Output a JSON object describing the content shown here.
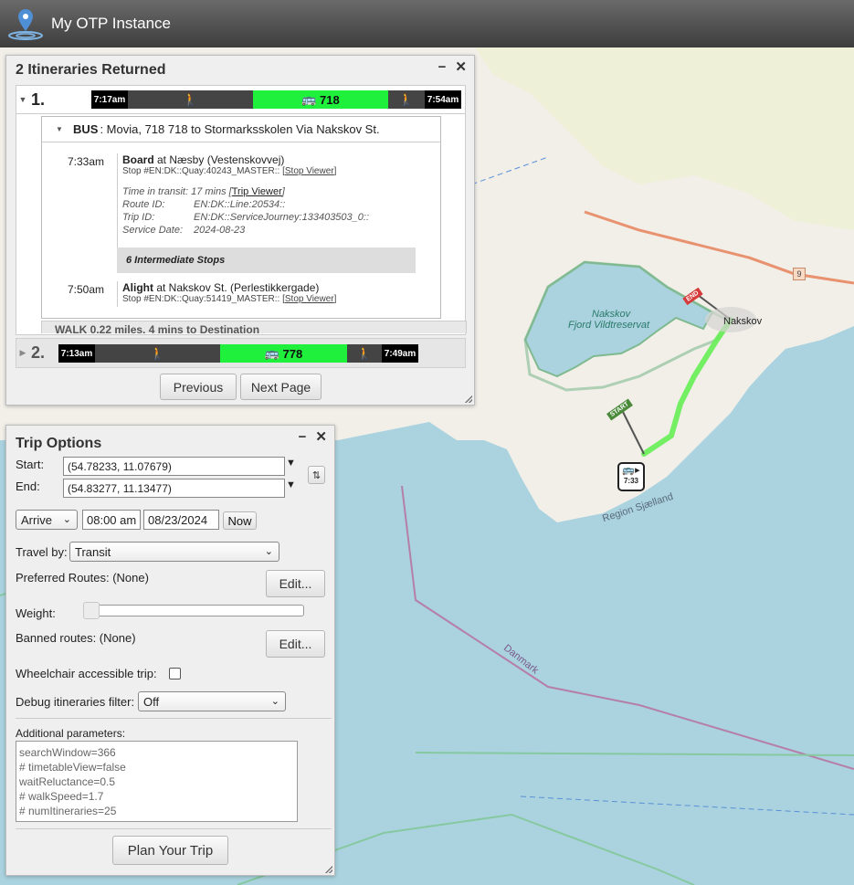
{
  "app": {
    "title": "My OTP Instance"
  },
  "map": {
    "labels": {
      "fjord1": "Nakskov",
      "fjord2": "Fjord Vildtreservat",
      "town": "Nakskov",
      "road_shield": "9",
      "region": "Region Sjælland",
      "border": "Danmark",
      "pin_time": "7:33",
      "start_flag": "START",
      "end_flag": "END"
    },
    "colors": {
      "water": "#aad3df",
      "land": "#f2efe9",
      "route": "#66ee55"
    }
  },
  "itineraries_panel": {
    "title": "2 Itineraries Returned",
    "minimize": "−",
    "close": "✕",
    "itineraries": [
      {
        "num": "1.",
        "start": "7:17am",
        "route": "718",
        "end": "7:54am"
      },
      {
        "num": "2.",
        "start": "7:13am",
        "route": "778",
        "end": "7:49am"
      }
    ],
    "leg": {
      "mode": "BUS",
      "summary": ": Movia, 718 718 to Stormarksskolen Via Nakskov St.",
      "board_time": "7:33am",
      "board_label": "Board",
      "board_text": " at Næsby (Vestenskovvej)",
      "board_stop": "Stop #EN:DK::Quay:40243_MASTER::",
      "stop_viewer": "Stop Viewer",
      "transit_time": "Time in transit: 17 mins",
      "trip_viewer": "Trip Viewer",
      "route_id_k": "Route ID:",
      "route_id_v": "EN:DK::Line:20534::",
      "trip_id_k": "Trip ID:",
      "trip_id_v": "EN:DK::ServiceJourney:133403503_0::",
      "service_date_k": "Service Date:",
      "service_date_v": "2024-08-23",
      "intermediate": "6 Intermediate Stops",
      "alight_time": "7:50am",
      "alight_label": "Alight",
      "alight_text": " at Nakskov St. (Perlestikkergade)",
      "alight_stop": "Stop #EN:DK::Quay:51419_MASTER::",
      "walk_summary": "WALK 0.22 miles, 4 mins to Destination"
    },
    "prev_button": "Previous",
    "next_button": "Next Page"
  },
  "trip_options": {
    "title": "Trip Options",
    "minimize": "−",
    "close": "✕",
    "start_label": "Start:",
    "start_value": "(54.78233, 11.07679)",
    "end_label": "End:",
    "end_value": "(54.83277, 11.13477)",
    "arrive_select": "Arrive",
    "time_value": "08:00 am",
    "date_value": "08/23/2024",
    "now_button": "Now",
    "travel_by_label": "Travel by:",
    "travel_by_value": "Transit",
    "preferred_routes_label": "Preferred Routes: (None)",
    "edit_button": "Edit...",
    "weight_label": "Weight:",
    "weight_level": 0,
    "banned_routes_label": "Banned routes: (None)",
    "wheelchair_label": "Wheelchair accessible trip:",
    "debug_label": "Debug itineraries filter:",
    "debug_value": "Off",
    "additional_label": "Additional parameters:",
    "additional_lines": [
      "searchWindow=366",
      "# timetableView=false",
      "waitReluctance=0.5",
      "# walkSpeed=1.7",
      "# numItineraries=25"
    ],
    "plan_button": "Plan Your Trip"
  }
}
